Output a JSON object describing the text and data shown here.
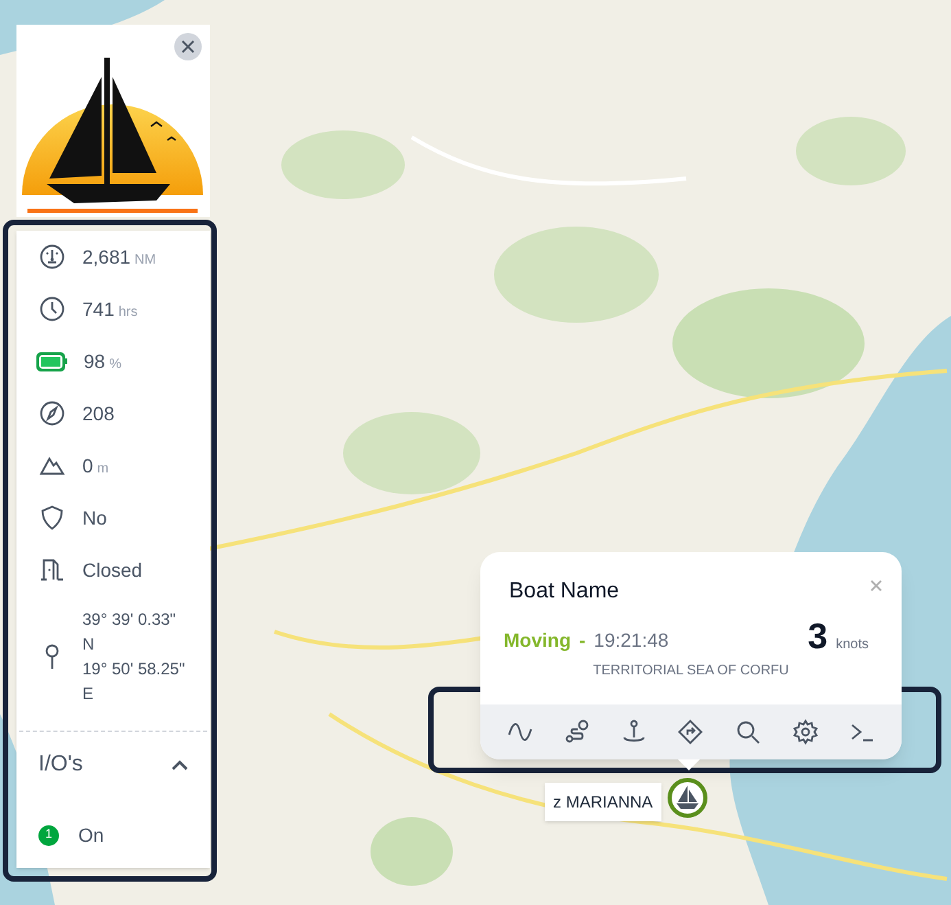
{
  "stats": [
    {
      "kind": "distance",
      "value": "2,681",
      "unit": "NM"
    },
    {
      "kind": "hours",
      "value": "741",
      "unit": "hrs"
    },
    {
      "kind": "battery",
      "value": "98",
      "unit": "%",
      "level": 0.98
    },
    {
      "kind": "heading",
      "value": "208"
    },
    {
      "kind": "altitude",
      "value": "0",
      "unit": "m"
    },
    {
      "kind": "shield",
      "value": "No"
    },
    {
      "kind": "door",
      "value": "Closed"
    },
    {
      "kind": "position",
      "lines": [
        "39° 39' 0.33\"",
        "N",
        "19° 50' 58.25\"",
        "E"
      ]
    }
  ],
  "io": {
    "title": "I/O's",
    "expanded": true,
    "items": [
      {
        "index": "1",
        "label": "On",
        "on": true
      }
    ]
  },
  "popup": {
    "title": "Boat Name",
    "status": "Moving",
    "separator": "-",
    "time": "19:21:48",
    "speed": "3",
    "speed_unit": "knots",
    "zone": "TERRITORIAL SEA OF CORFU",
    "tools": [
      {
        "kind": "wave"
      },
      {
        "kind": "route"
      },
      {
        "kind": "anchor"
      },
      {
        "kind": "directions"
      },
      {
        "kind": "search"
      },
      {
        "kind": "settings"
      },
      {
        "kind": "terminal"
      }
    ]
  },
  "marker": {
    "label": "z MARIANNA"
  }
}
